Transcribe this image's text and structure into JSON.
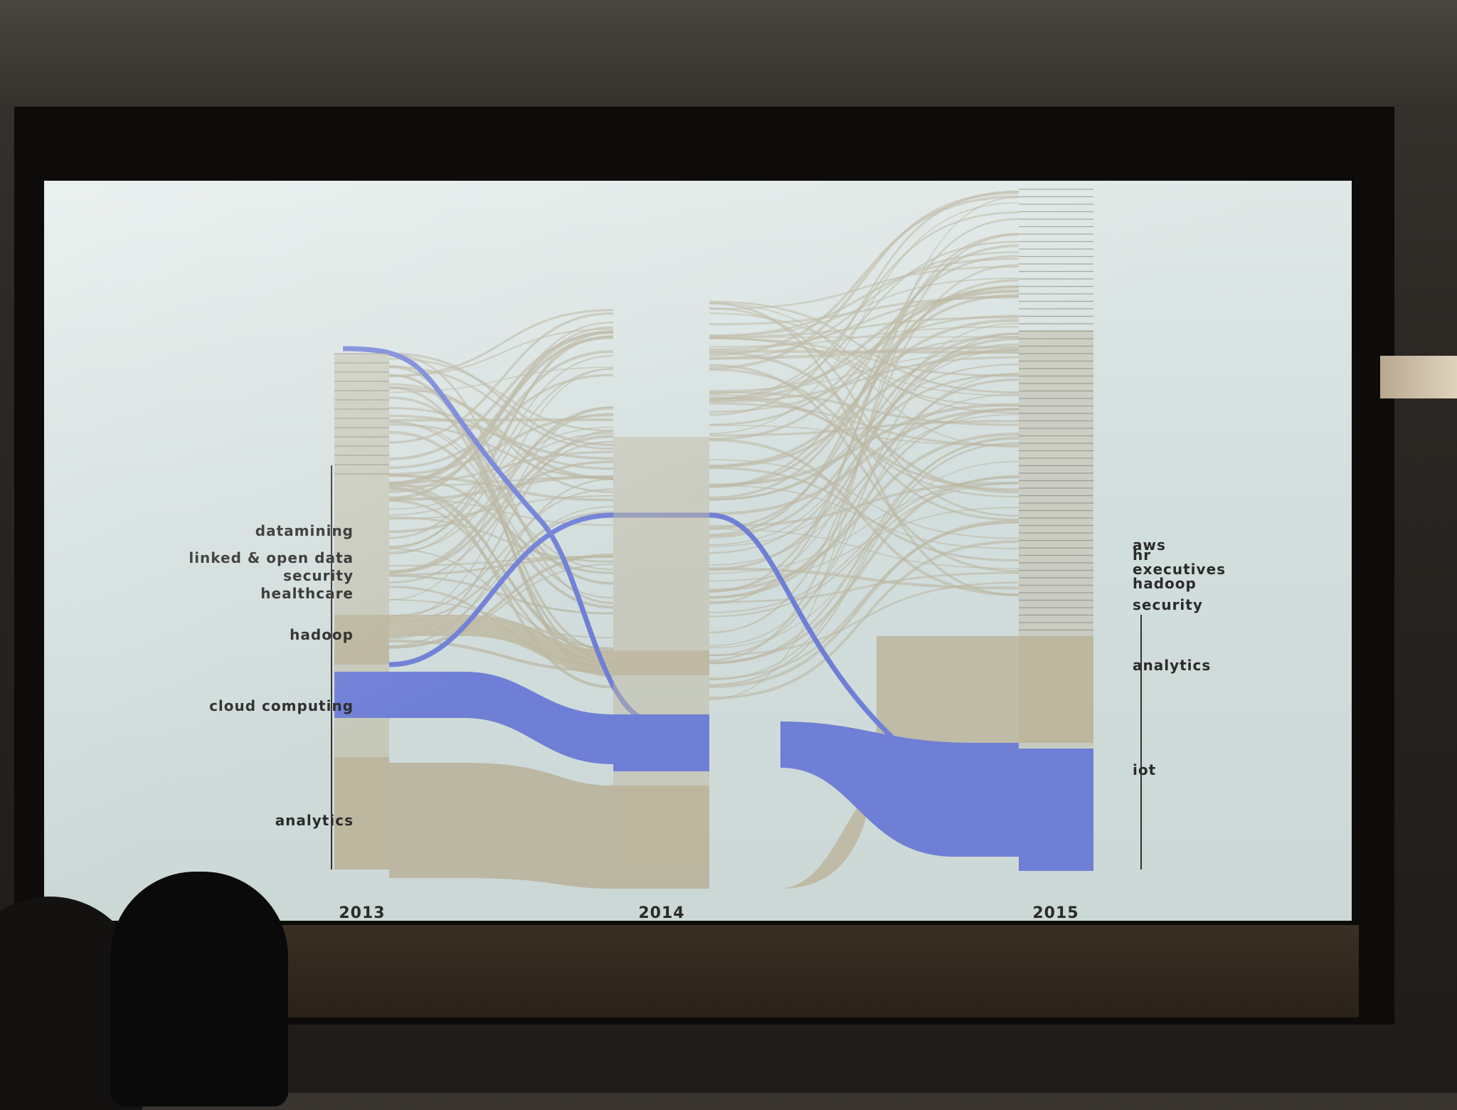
{
  "chart_data": {
    "type": "sankey",
    "columns": [
      "2013",
      "2014",
      "2015"
    ],
    "nodes_2013": [
      {
        "label": "datamining",
        "size": 2
      },
      {
        "label": "linked & open data",
        "size": 3
      },
      {
        "label": "security",
        "size": 3
      },
      {
        "label": "healthcare",
        "size": 3
      },
      {
        "label": "hadoop",
        "size": 9
      },
      {
        "label": "cloud computing",
        "size": 11
      },
      {
        "label": "analytics",
        "size": 22
      }
    ],
    "nodes_2015": [
      {
        "label": "aws",
        "size": 2
      },
      {
        "label": "hr",
        "size": 2
      },
      {
        "label": "executives",
        "size": 3
      },
      {
        "label": "hadoop",
        "size": 3
      },
      {
        "label": "security",
        "size": 4
      },
      {
        "label": "analytics",
        "size": 16
      },
      {
        "label": "iot",
        "size": 23
      }
    ],
    "highlight_color": "#6f7fd6",
    "flow_color": "#b9b39c"
  }
}
